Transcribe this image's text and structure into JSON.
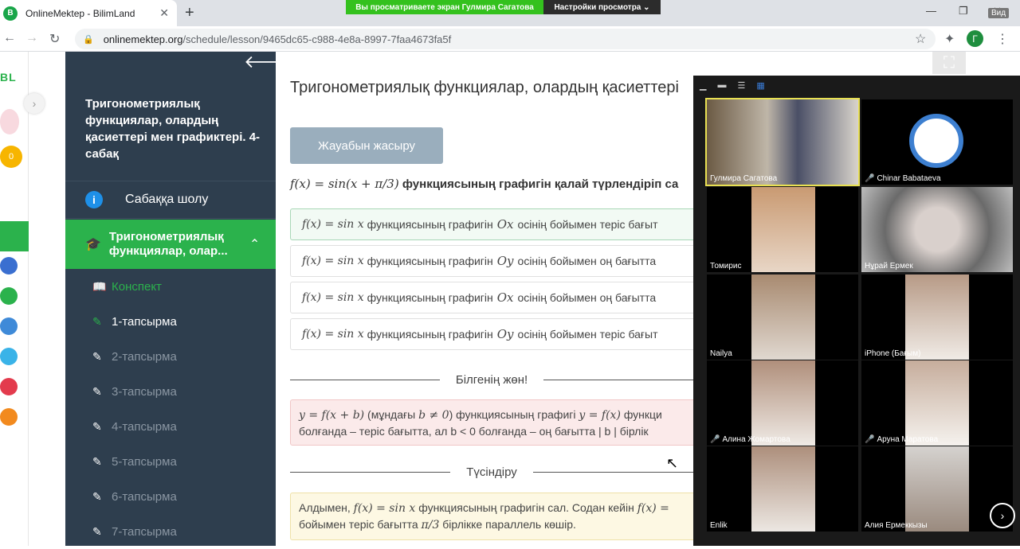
{
  "browser": {
    "tab_title": "OnlineMektep - BilimLand",
    "favicon_text": "B",
    "new_tab": "+",
    "url_host": "onlinemektep.org",
    "url_path": "/schedule/lesson/9465dc65-c988-4e8a-8997-7faa4673fa5f",
    "profile_initial": "Г",
    "share_banner": "Вы просматриваете экран Гулмира Сагатова",
    "view_settings": "Настройки просмотра",
    "view_label": "Вид"
  },
  "rail": {
    "logo": "BL",
    "coins": "0"
  },
  "sidebar": {
    "lesson_title": "Тригонометриялық функциялар, олардың қасиеттері мен графиктері. 4-сабақ",
    "overview": "Сабаққа шолу",
    "active_section": "Тригонометриялық функциялар, олар...",
    "items": [
      {
        "label": "Конспект"
      },
      {
        "label": "1-тапсырма"
      },
      {
        "label": "2-тапсырма"
      },
      {
        "label": "3-тапсырма"
      },
      {
        "label": "4-тапсырма"
      },
      {
        "label": "5-тапсырма"
      },
      {
        "label": "6-тапсырма"
      },
      {
        "label": "7-тапсырма"
      }
    ]
  },
  "main": {
    "title": "Тригонометриялық функциялар, олардың қасиеттері",
    "hide_answer": "Жауабын жасыру",
    "question_formula": "f(x) = sin(x + π/3)",
    "question_text": "функциясының графигін қалай түрлендіріп са",
    "options": [
      {
        "formula": "f(x) = sin x",
        "mid": "функциясының графигін",
        "axis": "Ox",
        "rest": "осінің бойымен теріс бағыт"
      },
      {
        "formula": "f(x) = sin x",
        "mid": "функциясының графигін",
        "axis": "Oy",
        "rest": "осінің бойымен оң бағытта"
      },
      {
        "formula": "f(x) = sin x",
        "mid": "функциясының графигін",
        "axis": "Ox",
        "rest": "осінің бойымен оң бағытта"
      },
      {
        "formula": "f(x) = sin x",
        "mid": "функциясының графигін",
        "axis": "Oy",
        "rest": "осінің бойымен теріс бағыт"
      }
    ],
    "know_label": "Білгенің жөн!",
    "know_line1_a": "y = f(x + b)",
    "know_line1_b": "(мұндағы",
    "know_line1_c": "b ≠ 0",
    "know_line1_d": ") функциясының графигі",
    "know_line1_e": "y = f(x)",
    "know_line1_f": "функци",
    "know_line2": "болғанда – теріс бағытта, ал b < 0 болғанда – оң бағытта | b | бірлік",
    "explain_label": "Түсіндіру",
    "expl_line1_a": "Алдымен,",
    "expl_line1_b": "f(x) = sin x",
    "expl_line1_c": "функциясының графигін сал. Содан кейін",
    "expl_line1_d": "f(x) =",
    "expl_line2_a": "бойымен теріс бағытта",
    "expl_line2_b": "π/3",
    "expl_line2_c": "бірлікке параллель көшір."
  },
  "video": {
    "participants": [
      {
        "name": "Гулмира Сагатова",
        "muted": false
      },
      {
        "name": "Chinar Babataeva",
        "muted": true
      },
      {
        "name": "Томирис",
        "muted": false
      },
      {
        "name": "Нұрай Ермек",
        "muted": false
      },
      {
        "name": "Nailya",
        "muted": false
      },
      {
        "name": "iPhone (Бағым)",
        "muted": false
      },
      {
        "name": "Алина Жомартова",
        "muted": true
      },
      {
        "name": "Аруна Маратова",
        "muted": true
      },
      {
        "name": "Enlik",
        "muted": false
      },
      {
        "name": "Алия Ермеккызы",
        "muted": false
      }
    ]
  }
}
